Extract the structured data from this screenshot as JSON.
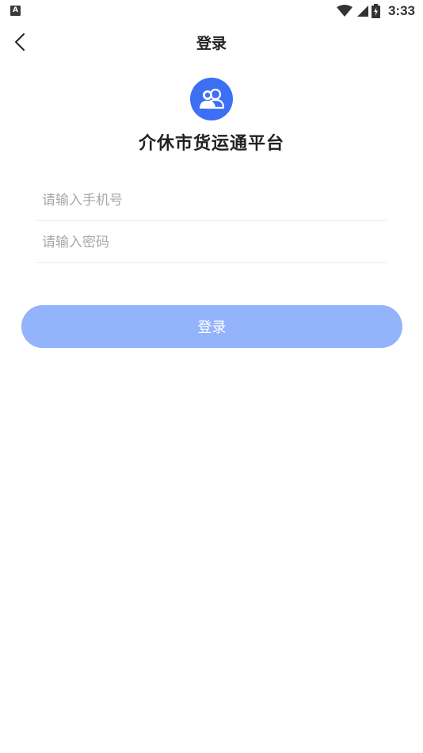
{
  "status_bar": {
    "app_icon_letter": "A",
    "time": "3:33",
    "icons": [
      "wifi-icon",
      "cellular-signal-icon",
      "battery-icon"
    ]
  },
  "nav": {
    "back_icon": "chevron-left-icon",
    "title": "登录"
  },
  "brand": {
    "logo_icon": "users-icon",
    "logo_color": "#3d6ff5",
    "app_name": "介休市货运通平台"
  },
  "form": {
    "phone_value": "",
    "phone_placeholder": "请输入手机号",
    "password_value": "",
    "password_placeholder": "请输入密码",
    "login_label": "登录",
    "login_button_color": "#93b3fb"
  }
}
